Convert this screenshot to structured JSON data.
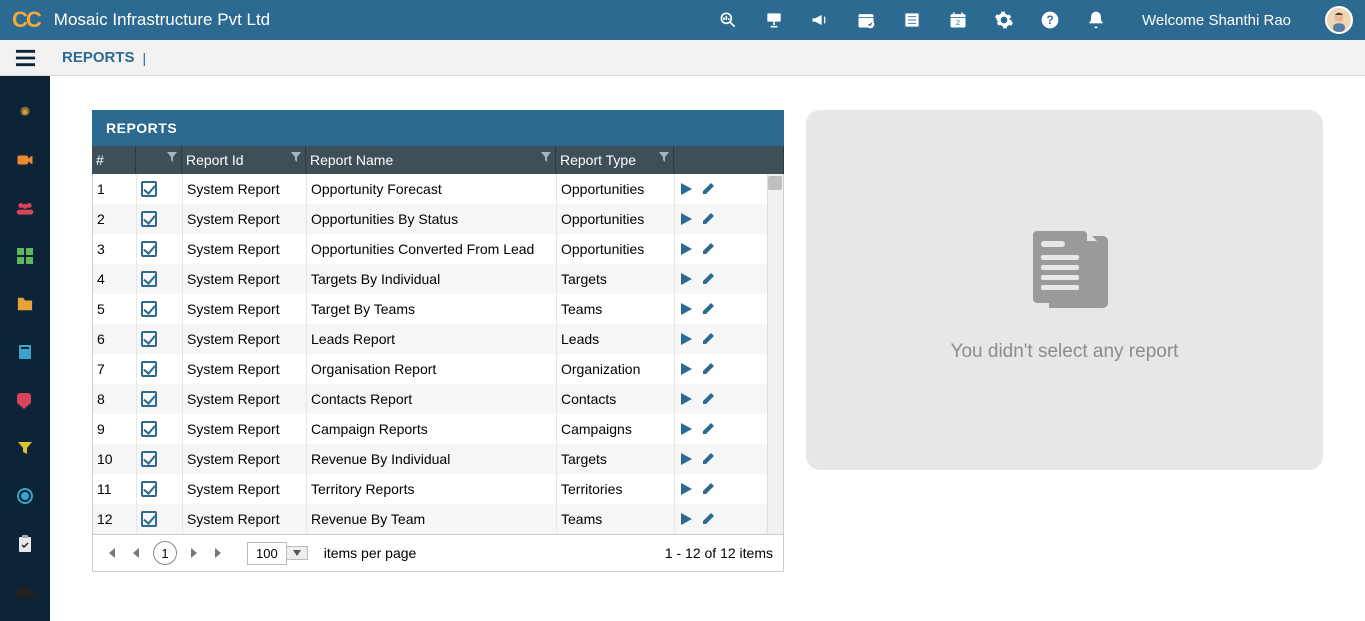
{
  "header": {
    "logo": "CC",
    "company": "Mosaic Infrastructure Pvt Ltd",
    "welcome": "Welcome Shanthi Rao"
  },
  "breadcrumb": {
    "label": "REPORTS",
    "sep": "|"
  },
  "panel": {
    "title": "REPORTS",
    "columns": {
      "num": "#",
      "id": "Report Id",
      "name": "Report Name",
      "type": "Report Type"
    },
    "rows": [
      {
        "n": "1",
        "id": "System Report",
        "name": "Opportunity Forecast",
        "type": "Opportunities"
      },
      {
        "n": "2",
        "id": "System Report",
        "name": "Opportunities By Status",
        "type": "Opportunities"
      },
      {
        "n": "3",
        "id": "System Report",
        "name": "Opportunities Converted From Lead",
        "type": "Opportunities"
      },
      {
        "n": "4",
        "id": "System Report",
        "name": "Targets By Individual",
        "type": "Targets"
      },
      {
        "n": "5",
        "id": "System Report",
        "name": "Target By Teams",
        "type": "Teams"
      },
      {
        "n": "6",
        "id": "System Report",
        "name": "Leads Report",
        "type": "Leads"
      },
      {
        "n": "7",
        "id": "System Report",
        "name": "Organisation Report",
        "type": "Organization"
      },
      {
        "n": "8",
        "id": "System Report",
        "name": "Contacts Report",
        "type": "Contacts"
      },
      {
        "n": "9",
        "id": "System Report",
        "name": "Campaign Reports",
        "type": "Campaigns"
      },
      {
        "n": "10",
        "id": "System Report",
        "name": "Revenue By Individual",
        "type": "Targets"
      },
      {
        "n": "11",
        "id": "System Report",
        "name": "Territory Reports",
        "type": "Territories"
      },
      {
        "n": "12",
        "id": "System Report",
        "name": "Revenue By Team",
        "type": "Teams"
      }
    ]
  },
  "pager": {
    "page": "1",
    "size": "100",
    "perPage": "items per page",
    "summary": "1 - 12 of 12 items"
  },
  "placeholder": {
    "text": "You didn't select any report"
  }
}
